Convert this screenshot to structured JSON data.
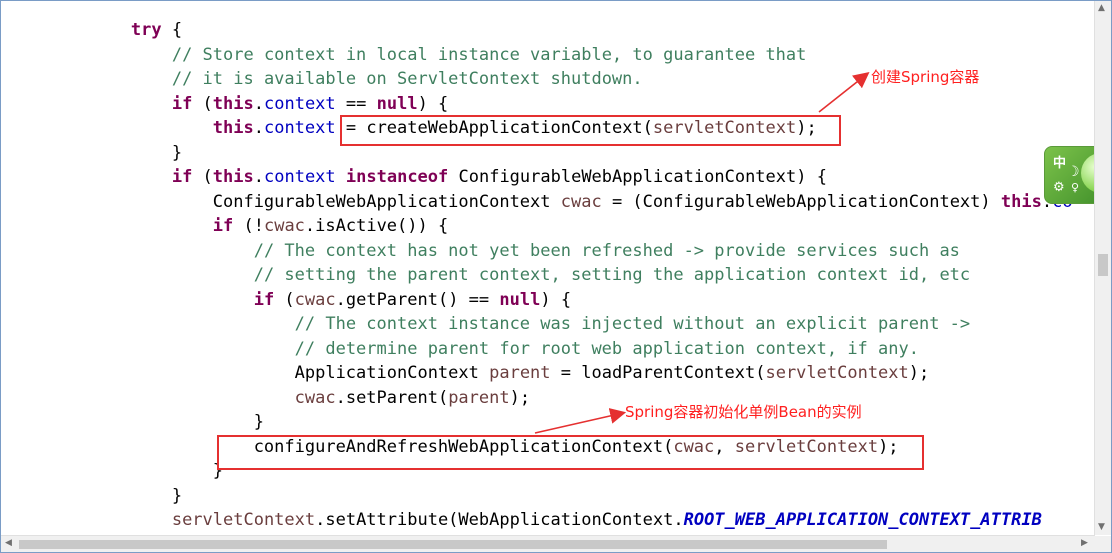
{
  "code": {
    "lines": [
      [
        {
          "t": "        "
        },
        {
          "t": "try",
          "c": "kw"
        },
        {
          "t": " {"
        }
      ],
      [
        {
          "t": "            "
        },
        {
          "t": "// Store context in local instance variable, to guarantee that",
          "c": "cm"
        }
      ],
      [
        {
          "t": "            "
        },
        {
          "t": "// it is available on ServletContext shutdown.",
          "c": "cm"
        }
      ],
      [
        {
          "t": "            "
        },
        {
          "t": "if",
          "c": "kw"
        },
        {
          "t": " ("
        },
        {
          "t": "this",
          "c": "kw"
        },
        {
          "t": "."
        },
        {
          "t": "context",
          "c": "fld"
        },
        {
          "t": " == "
        },
        {
          "t": "null",
          "c": "kw"
        },
        {
          "t": ") {"
        }
      ],
      [
        {
          "t": "                "
        },
        {
          "t": "this",
          "c": "kw"
        },
        {
          "t": "."
        },
        {
          "t": "context",
          "c": "fld"
        },
        {
          "t": " = createWebApplicationContext("
        },
        {
          "t": "servletContext",
          "c": "var"
        },
        {
          "t": ");"
        }
      ],
      [
        {
          "t": "            }"
        }
      ],
      [
        {
          "t": "            "
        },
        {
          "t": "if",
          "c": "kw"
        },
        {
          "t": " ("
        },
        {
          "t": "this",
          "c": "kw"
        },
        {
          "t": "."
        },
        {
          "t": "context",
          "c": "fld"
        },
        {
          "t": " "
        },
        {
          "t": "instanceof",
          "c": "kw"
        },
        {
          "t": " ConfigurableWebApplicationContext) {"
        }
      ],
      [
        {
          "t": "                ConfigurableWebApplicationContext "
        },
        {
          "t": "cwac",
          "c": "var"
        },
        {
          "t": " = (ConfigurableWebApplicationContext) "
        },
        {
          "t": "this",
          "c": "kw"
        },
        {
          "t": "."
        },
        {
          "t": "co",
          "c": "fld"
        }
      ],
      [
        {
          "t": "                "
        },
        {
          "t": "if",
          "c": "kw"
        },
        {
          "t": " (!"
        },
        {
          "t": "cwac",
          "c": "var"
        },
        {
          "t": ".isActive()) {"
        }
      ],
      [
        {
          "t": "                    "
        },
        {
          "t": "// The context has not yet been refreshed -> provide services such as",
          "c": "cm"
        }
      ],
      [
        {
          "t": "                    "
        },
        {
          "t": "// setting the parent context, setting the application context id, etc",
          "c": "cm"
        }
      ],
      [
        {
          "t": "                    "
        },
        {
          "t": "if",
          "c": "kw"
        },
        {
          "t": " ("
        },
        {
          "t": "cwac",
          "c": "var"
        },
        {
          "t": ".getParent() == "
        },
        {
          "t": "null",
          "c": "kw"
        },
        {
          "t": ") {"
        }
      ],
      [
        {
          "t": "                        "
        },
        {
          "t": "// The context instance was injected without an explicit parent ->",
          "c": "cm"
        }
      ],
      [
        {
          "t": "                        "
        },
        {
          "t": "// determine parent for root web application context, if any.",
          "c": "cm"
        }
      ],
      [
        {
          "t": "                        ApplicationContext "
        },
        {
          "t": "parent",
          "c": "var"
        },
        {
          "t": " = loadParentContext("
        },
        {
          "t": "servletContext",
          "c": "var"
        },
        {
          "t": ");"
        }
      ],
      [
        {
          "t": "                        "
        },
        {
          "t": "cwac",
          "c": "var"
        },
        {
          "t": ".setParent("
        },
        {
          "t": "parent",
          "c": "var"
        },
        {
          "t": ");"
        }
      ],
      [
        {
          "t": "                    }"
        }
      ],
      [
        {
          "t": "                    configureAndRefreshWebApplicationContext("
        },
        {
          "t": "cwac",
          "c": "var"
        },
        {
          "t": ", "
        },
        {
          "t": "servletContext",
          "c": "var"
        },
        {
          "t": ");"
        }
      ],
      [
        {
          "t": "                }"
        }
      ],
      [
        {
          "t": "            }"
        }
      ],
      [
        {
          "t": "            "
        },
        {
          "t": "servletContext",
          "c": "var"
        },
        {
          "t": ".setAttribute(WebApplicationContext."
        },
        {
          "t": "ROOT_WEB_APPLICATION_CONTEXT_ATTRIB",
          "c": "cst"
        }
      ]
    ]
  },
  "annotations": {
    "create_container": "创建Spring容器",
    "init_singletons": "Spring容器初始化单例Bean的实例"
  },
  "ime_widget": {
    "mode_label": "中",
    "moon_glyph": "☽",
    "gear_glyph": "⚙",
    "mic_glyph": "♀"
  },
  "scrollbars": {
    "up": "▲",
    "down": "▼",
    "left": "◀",
    "right": "▶"
  },
  "colors": {
    "keyword": "#7f0055",
    "comment": "#3f7f5f",
    "field": "#0000c0",
    "variable": "#6a3e3e",
    "annotation": "#ff2020",
    "highlight_box": "#e53030"
  }
}
